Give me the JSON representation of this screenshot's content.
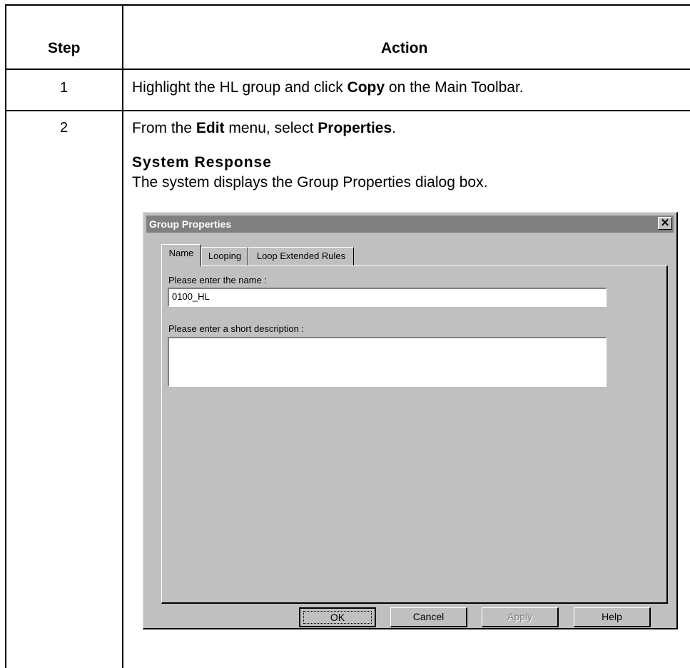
{
  "table": {
    "headers": {
      "step": "Step",
      "action": "Action"
    },
    "rows": [
      {
        "step": "1",
        "parts": [
          "Highlight the HL group and click ",
          "Copy",
          " on the Main Toolbar."
        ]
      },
      {
        "step": "2",
        "parts": [
          "From the ",
          "Edit",
          " menu, select ",
          "Properties",
          "."
        ],
        "system_response_title": "System Response",
        "system_response_text": "The system displays the Group Properties dialog box."
      }
    ]
  },
  "dialog": {
    "title": "Group Properties",
    "close_glyph": "✕",
    "tabs": [
      "Name",
      "Looping",
      "Loop Extended Rules"
    ],
    "active_tab": "Name",
    "name_label": "Please enter the name :",
    "name_value": "0100_HL",
    "desc_label": "Please enter a short description :",
    "desc_value": "",
    "buttons": {
      "ok": "OK",
      "cancel": "Cancel",
      "apply": "Apply",
      "help": "Help"
    },
    "colors": {
      "face": "#c0c0c0",
      "titlebar_inactive": "#808080"
    }
  }
}
